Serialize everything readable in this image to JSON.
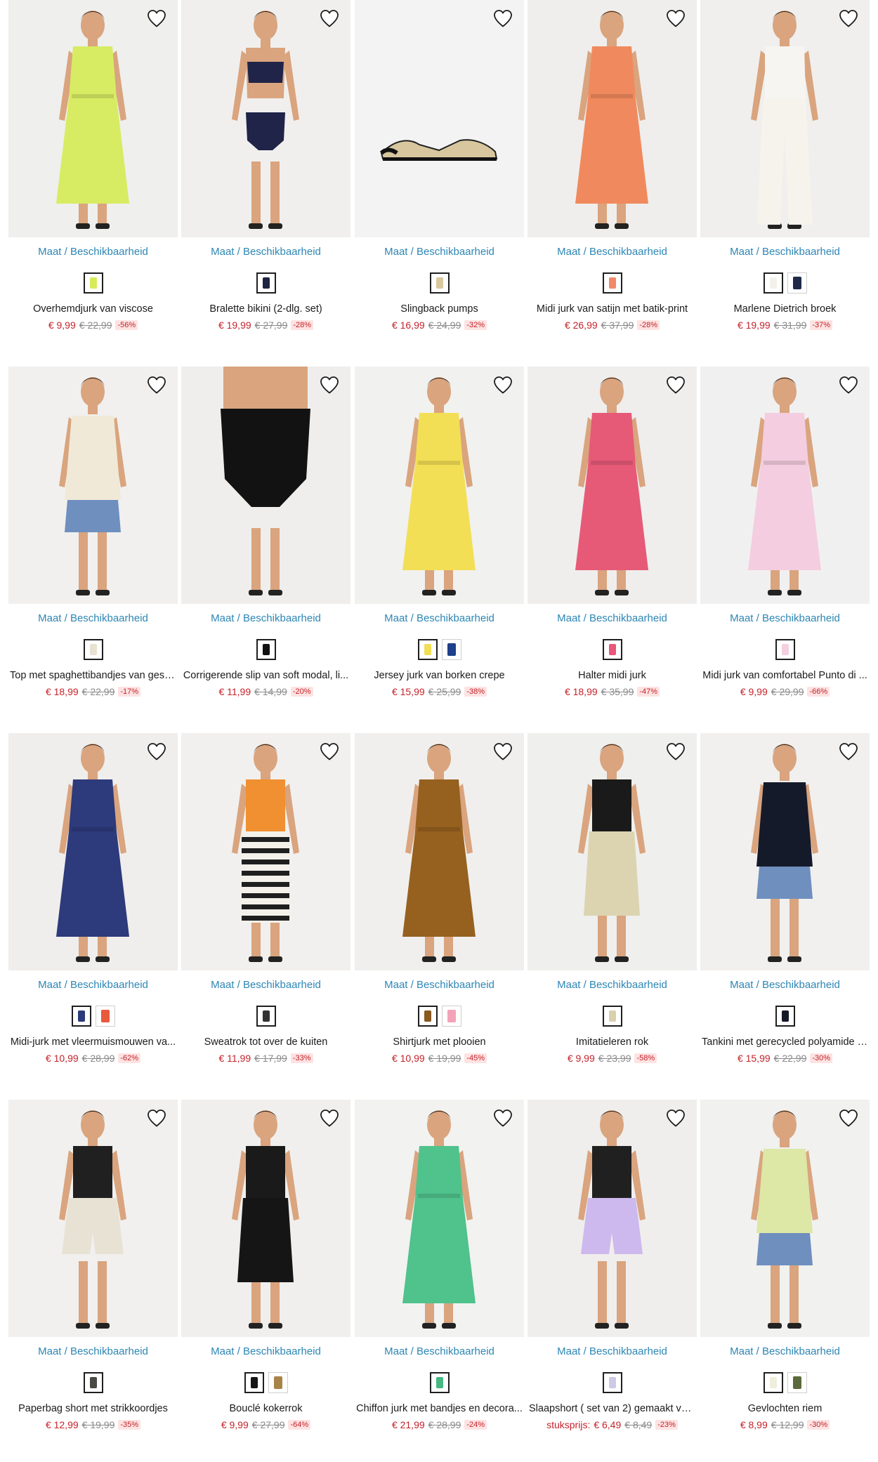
{
  "grid": {
    "availability_label": "Maat / Beschikbaarheid",
    "products": [
      {
        "name": "Overhemdjurk van viscose",
        "price": "€ 9,99",
        "old_price": "€ 22,99",
        "discount": "-56%",
        "swatches": [
          "#d6ec5a"
        ],
        "look": {
          "bg": "#efefed",
          "main": "#d8ec63",
          "kind": "dress"
        }
      },
      {
        "name": "Bralette bikini (2-dlg. set)",
        "price": "€ 19,99",
        "old_price": "€ 27,99",
        "discount": "-28%",
        "swatches": [
          "#1d2340"
        ],
        "look": {
          "bg": "#f1efed",
          "main": "#1f2448",
          "kind": "bikini"
        }
      },
      {
        "name": "Slingback pumps",
        "price": "€ 16,99",
        "old_price": "€ 24,99",
        "discount": "-32%",
        "swatches": [
          "#d9c79e"
        ],
        "look": {
          "bg": "#f3f3f3",
          "main": "#d8c69e",
          "kind": "shoe"
        }
      },
      {
        "name": "Midi jurk van satijn met batik-print",
        "price": "€ 26,99",
        "old_price": "€ 37,99",
        "discount": "-28%",
        "swatches": [
          "#f08a6a"
        ],
        "look": {
          "bg": "#efeeec",
          "main": "#f08a5e",
          "kind": "dress"
        }
      },
      {
        "name": "Marlene Dietrich broek",
        "price": "€ 19,99",
        "old_price": "€ 31,99",
        "discount": "-37%",
        "swatches": [
          "#f4f1ea",
          "#1f2a4a"
        ],
        "look": {
          "bg": "#f0efed",
          "main": "#f6f3ec",
          "kind": "pants"
        }
      },
      {
        "name": "Top met spaghettibandjes van gestr...",
        "price": "€ 18,99",
        "old_price": "€ 22,99",
        "discount": "-17%",
        "swatches": [
          "#e9e2d2"
        ],
        "look": {
          "bg": "#f1f0ee",
          "main": "#f0e9d8",
          "kind": "top"
        }
      },
      {
        "name": "Corrigerende slip van soft modal, li...",
        "price": "€ 11,99",
        "old_price": "€ 14,99",
        "discount": "-20%",
        "swatches": [
          "#111111"
        ],
        "look": {
          "bg": "#efeeec",
          "main": "#121212",
          "kind": "brief"
        }
      },
      {
        "name": "Jersey jurk van borken crepe",
        "price": "€ 15,99",
        "old_price": "€ 25,99",
        "discount": "-38%",
        "swatches": [
          "#f2de55",
          "#1e3f8a"
        ],
        "look": {
          "bg": "#f1f1ef",
          "main": "#f3df55",
          "kind": "dress"
        }
      },
      {
        "name": "Halter midi jurk",
        "price": "€ 18,99",
        "old_price": "€ 35,99",
        "discount": "-47%",
        "swatches": [
          "#e9577a"
        ],
        "look": {
          "bg": "#efeeec",
          "main": "#e65a78",
          "kind": "dress"
        }
      },
      {
        "name": "Midi jurk van comfortabel Punto di ...",
        "price": "€ 9,99",
        "old_price": "€ 29,99",
        "discount": "-66%",
        "swatches": [
          "#f5cfe0"
        ],
        "look": {
          "bg": "#f1f0f0",
          "main": "#f4cde0",
          "kind": "dress"
        }
      },
      {
        "name": "Midi-jurk met vleermuismouwen va...",
        "price": "€ 10,99",
        "old_price": "€ 28,99",
        "discount": "-62%",
        "swatches": [
          "#2c3a78",
          "#e85a3c"
        ],
        "look": {
          "bg": "#efeeec",
          "main": "#2d3a7b",
          "kind": "dress"
        }
      },
      {
        "name": "Sweatrok tot over de kuiten",
        "price": "€ 11,99",
        "old_price": "€ 17,99",
        "discount": "-33%",
        "swatches": [
          "#333333"
        ],
        "look": {
          "bg": "#f1f0ee",
          "main": "#1f1f1f",
          "kind": "stripeskirt"
        }
      },
      {
        "name": "Shirtjurk met plooien",
        "price": "€ 10,99",
        "old_price": "€ 19,99",
        "discount": "-45%",
        "swatches": [
          "#8a5a1e",
          "#f3a3b8"
        ],
        "look": {
          "bg": "#f0efed",
          "main": "#96601f",
          "kind": "dress"
        }
      },
      {
        "name": "Imitatieleren rok",
        "price": "€ 9,99",
        "old_price": "€ 23,99",
        "discount": "-58%",
        "swatches": [
          "#d9d1ae"
        ],
        "look": {
          "bg": "#efefed",
          "main": "#dcd4b0",
          "kind": "skirt"
        }
      },
      {
        "name": "Tankini met gerecycled polyamide (...",
        "price": "€ 15,99",
        "old_price": "€ 22,99",
        "discount": "-30%",
        "swatches": [
          "#151a28"
        ],
        "look": {
          "bg": "#f1f0ee",
          "main": "#151a2a",
          "kind": "top"
        }
      },
      {
        "name": "Paperbag short met strikkoordjes",
        "price": "€ 12,99",
        "old_price": "€ 19,99",
        "discount": "-35%",
        "swatches": [
          "#4a4a44"
        ],
        "look": {
          "bg": "#f1f0ee",
          "main": "#e8e2d4",
          "kind": "shorts"
        }
      },
      {
        "name": "Bouclé kokerrok",
        "price": "€ 9,99",
        "old_price": "€ 27,99",
        "discount": "-64%",
        "swatches": [
          "#151515",
          "#a8844a"
        ],
        "look": {
          "bg": "#f0efed",
          "main": "#151515",
          "kind": "skirt"
        }
      },
      {
        "name": "Chiffon jurk met bandjes en decora...",
        "price": "€ 21,99",
        "old_price": "€ 28,99",
        "discount": "-24%",
        "swatches": [
          "#46b882"
        ],
        "look": {
          "bg": "#f2f2f0",
          "main": "#50c28c",
          "kind": "dress"
        }
      },
      {
        "name": "Slaapshort ( set van 2) gemaakt van ...",
        "price_label": "stuksprijs:",
        "price": "€ 6,49",
        "old_price": "€ 8,49",
        "discount": "-23%",
        "swatches": [
          "#cfc9e6"
        ],
        "look": {
          "bg": "#efeeec",
          "main": "#cdb9ee",
          "kind": "shorts"
        }
      },
      {
        "name": "Gevlochten riem",
        "price": "€ 8,99",
        "old_price": "€ 12,99",
        "discount": "-30%",
        "swatches": [
          "#f0eedc",
          "#5a6a3a"
        ],
        "look": {
          "bg": "#f1f1ef",
          "main": "#dde7a6",
          "kind": "top"
        }
      }
    ]
  }
}
